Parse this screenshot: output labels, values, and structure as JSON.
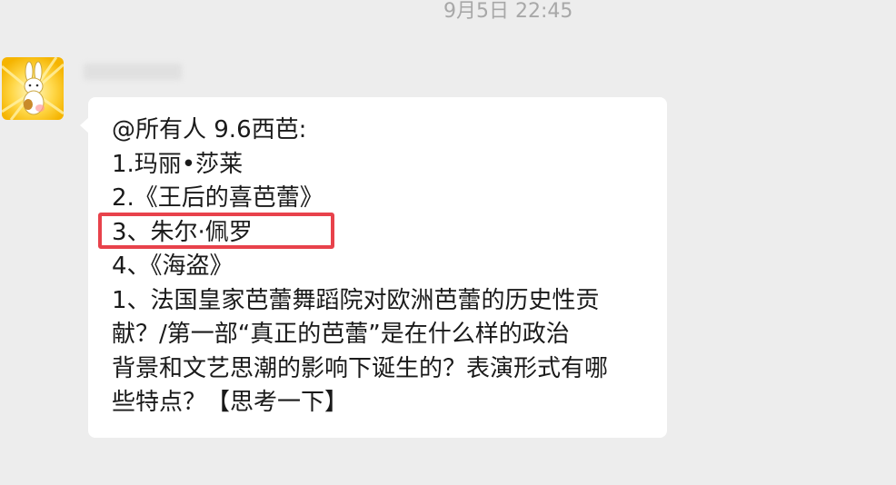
{
  "chat": {
    "timestamp": "9月5日 22:45"
  },
  "message": {
    "sender_avatar_icon": "cartoon-rabbit-avatar-icon",
    "lines": [
      "@所有人 9.6西芭:",
      "1.玛丽•莎莱",
      "2.《王后的喜芭蕾》",
      "3、朱尔·佩罗",
      "4、《海盗》",
      "1、法国皇家芭蕾舞蹈院对欧洲芭蕾的历史性贡",
      "献？/第一部“真正的芭蕾”是在什么样的政治",
      "背景和文艺思潮的影响下诞生的？表演形式有哪",
      "些特点？【思考一下】"
    ]
  },
  "colors": {
    "background": "#ededed",
    "bubble": "#ffffff",
    "highlight_box": "#e8424b"
  }
}
